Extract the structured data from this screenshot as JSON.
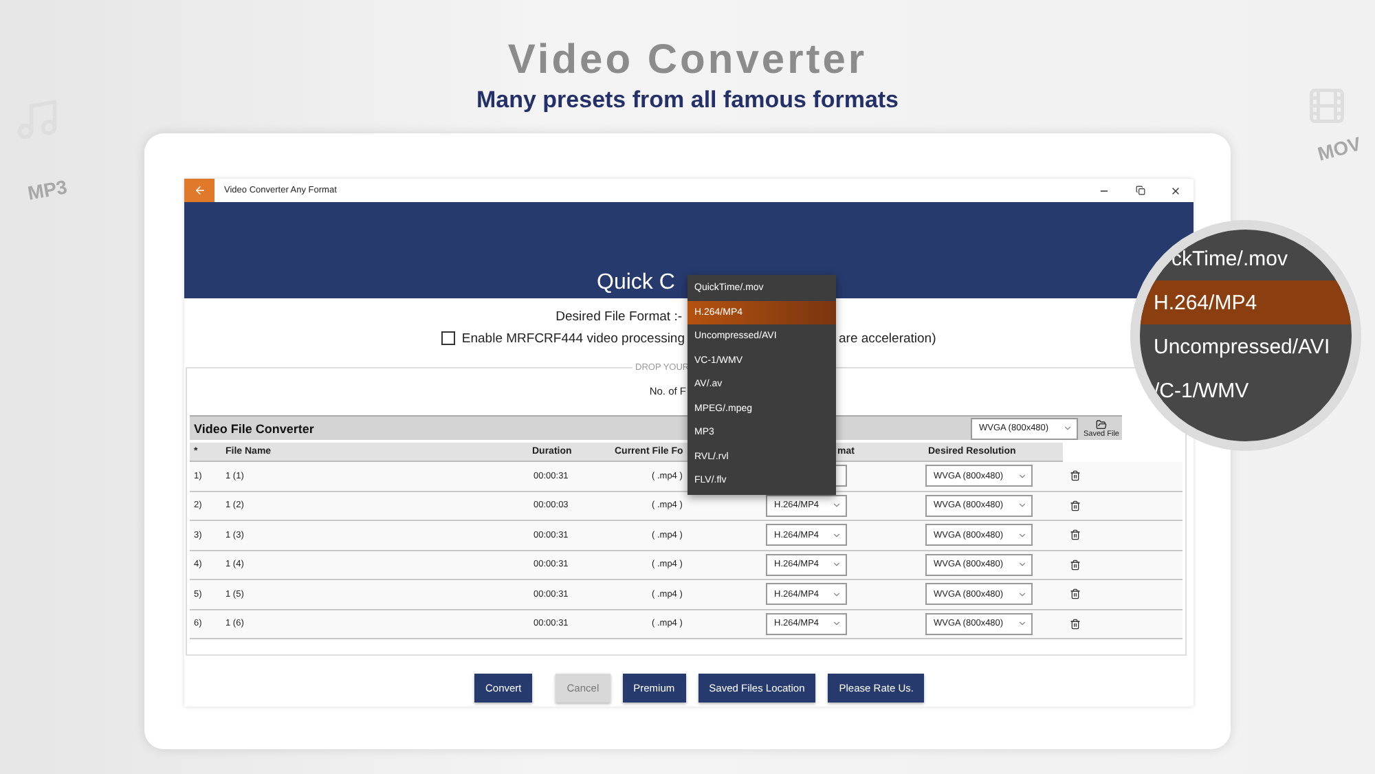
{
  "header": {
    "title": "Video Converter",
    "subtitle": "Many presets from all famous formats"
  },
  "decor_labels": [
    "MP3",
    "MOV"
  ],
  "window": {
    "title": "Video Converter Any Format"
  },
  "banner": {
    "title": "Quick C"
  },
  "format_label": "Desired File Format :-",
  "option": {
    "label": "Enable MRFCRF444 video processing",
    "label_tail": "are acceleration)",
    "checked": false
  },
  "drop_zone": {
    "legend": "DROP YOUR",
    "count_label": "No. of F"
  },
  "table": {
    "title": "Video File Converter",
    "resolution": "WVGA (800x480)",
    "saved_file": "Saved File",
    "columns": [
      "*",
      "File Name",
      "Duration",
      "Current File Fo",
      "mat",
      "Desired Resolution"
    ],
    "rows": [
      {
        "index": "1)",
        "name": "1 (1)",
        "duration": "00:00:31",
        "current": "( .mp4 )",
        "resolution": "WVGA (800x480)"
      },
      {
        "index": "2)",
        "name": "1 (2)",
        "duration": "00:00:03",
        "current": "( .mp4 )",
        "format": "H.264/MP4",
        "resolution": "WVGA (800x480)"
      },
      {
        "index": "3)",
        "name": "1 (3)",
        "duration": "00:00:31",
        "current": "( .mp4 )",
        "format": "H.264/MP4",
        "resolution": "WVGA (800x480)"
      },
      {
        "index": "4)",
        "name": "1 (4)",
        "duration": "00:00:31",
        "current": "( .mp4 )",
        "format": "H.264/MP4",
        "resolution": "WVGA (800x480)"
      },
      {
        "index": "5)",
        "name": "1 (5)",
        "duration": "00:00:31",
        "current": "( .mp4 )",
        "format": "H.264/MP4",
        "resolution": "WVGA (800x480)"
      },
      {
        "index": "6)",
        "name": "1 (6)",
        "duration": "00:00:31",
        "current": "( .mp4 )",
        "format": "H.264/MP4",
        "resolution": "WVGA (800x480)"
      }
    ]
  },
  "format_menu": {
    "items": [
      {
        "label": "QuickTime/.mov",
        "selected": false
      },
      {
        "label": "H.264/MP4",
        "selected": true
      },
      {
        "label": "Uncompressed/AVI",
        "selected": false
      },
      {
        "label": "VC-1/WMV",
        "selected": false
      },
      {
        "label": "AV/.av",
        "selected": false
      },
      {
        "label": "MPEG/.mpeg",
        "selected": false
      },
      {
        "label": "MP3",
        "selected": false
      },
      {
        "label": "RVL/.rvl",
        "selected": false
      },
      {
        "label": "FLV/.flv",
        "selected": false
      }
    ]
  },
  "magnifier": {
    "items": [
      {
        "label": "ckTime/.mov",
        "selected": false
      },
      {
        "label": "H.264/MP4",
        "selected": true
      },
      {
        "label": "Uncompressed/AVI",
        "selected": false
      },
      {
        "label": "/C-1/WMV",
        "selected": false
      }
    ]
  },
  "buttons": [
    {
      "label": "Convert",
      "disabled": false
    },
    {
      "label": "Cancel",
      "disabled": true
    },
    {
      "label": "Premium",
      "disabled": false
    },
    {
      "label": "Saved Files Location",
      "disabled": false
    },
    {
      "label": "Please Rate Us.",
      "disabled": false
    }
  ]
}
